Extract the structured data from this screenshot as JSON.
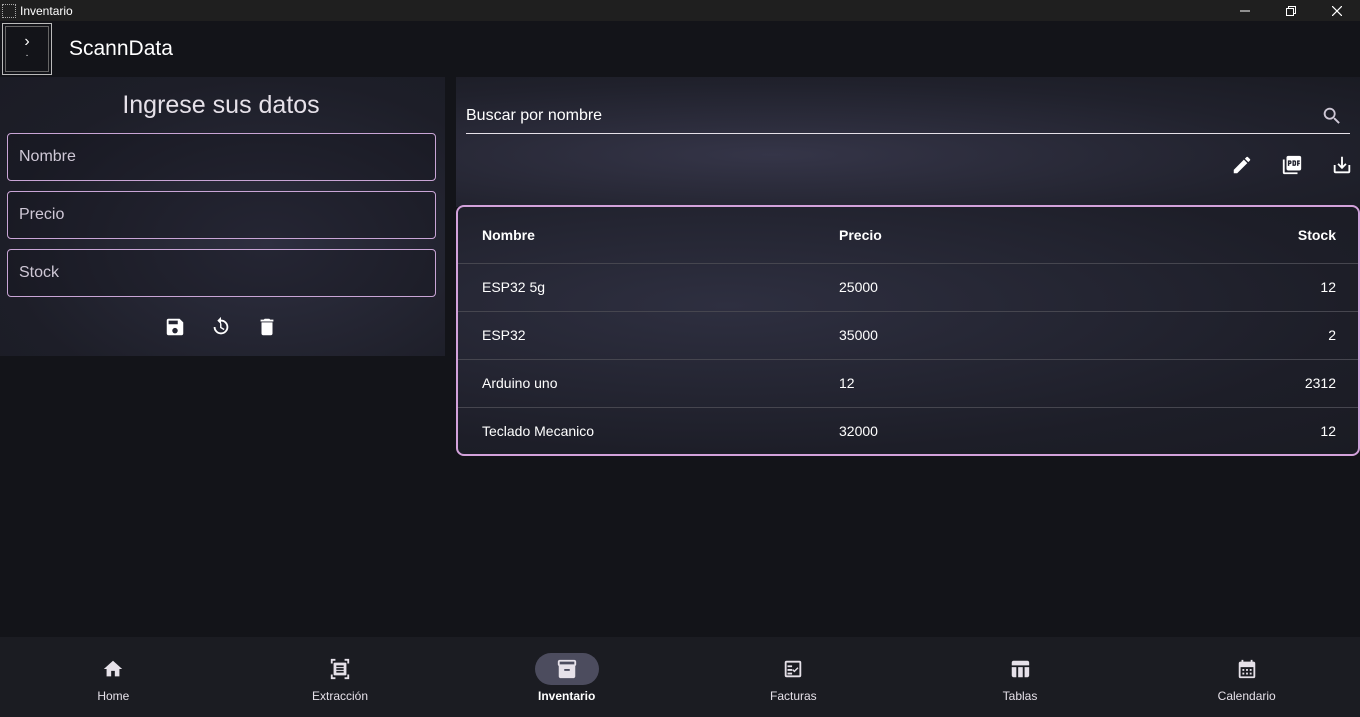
{
  "window": {
    "title": "Inventario",
    "controls": [
      "minimize-icon",
      "restore-icon",
      "close-icon"
    ]
  },
  "appbar": {
    "title": "ScannData",
    "menu_icon": "chevron-right-icon"
  },
  "form": {
    "title": "Ingrese sus datos",
    "fields": {
      "nombre": {
        "placeholder": "Nombre",
        "value": ""
      },
      "precio": {
        "placeholder": "Precio",
        "value": ""
      },
      "stock": {
        "placeholder": "Stock",
        "value": ""
      }
    },
    "actions": [
      "save-icon",
      "refresh-icon",
      "delete-icon"
    ]
  },
  "search": {
    "placeholder": "Buscar por nombre",
    "icon": "search-icon"
  },
  "table_actions": [
    "edit-icon",
    "pdf-icon",
    "download-icon"
  ],
  "table": {
    "headers": [
      "Nombre",
      "Precio",
      "Stock"
    ],
    "rows": [
      [
        "ESP32 5g",
        "25000",
        "12"
      ],
      [
        "ESP32",
        "35000",
        "2"
      ],
      [
        "Arduino uno",
        "12",
        "2312"
      ],
      [
        "Teclado Mecanico",
        "32000",
        "12"
      ]
    ]
  },
  "nav": {
    "items": [
      {
        "label": "Home",
        "icon": "home-icon",
        "active": false
      },
      {
        "label": "Extracción",
        "icon": "document-scanner-icon",
        "active": false
      },
      {
        "label": "Inventario",
        "icon": "inventory-icon",
        "active": true
      },
      {
        "label": "Facturas",
        "icon": "receipt-check-icon",
        "active": false
      },
      {
        "label": "Tablas",
        "icon": "table-icon",
        "active": false
      },
      {
        "label": "Calendario",
        "icon": "calendar-icon",
        "active": false
      }
    ]
  },
  "colors": {
    "accent_border": "#d3a2db",
    "background": "#131419",
    "active_pill": "#4c4c5e"
  }
}
